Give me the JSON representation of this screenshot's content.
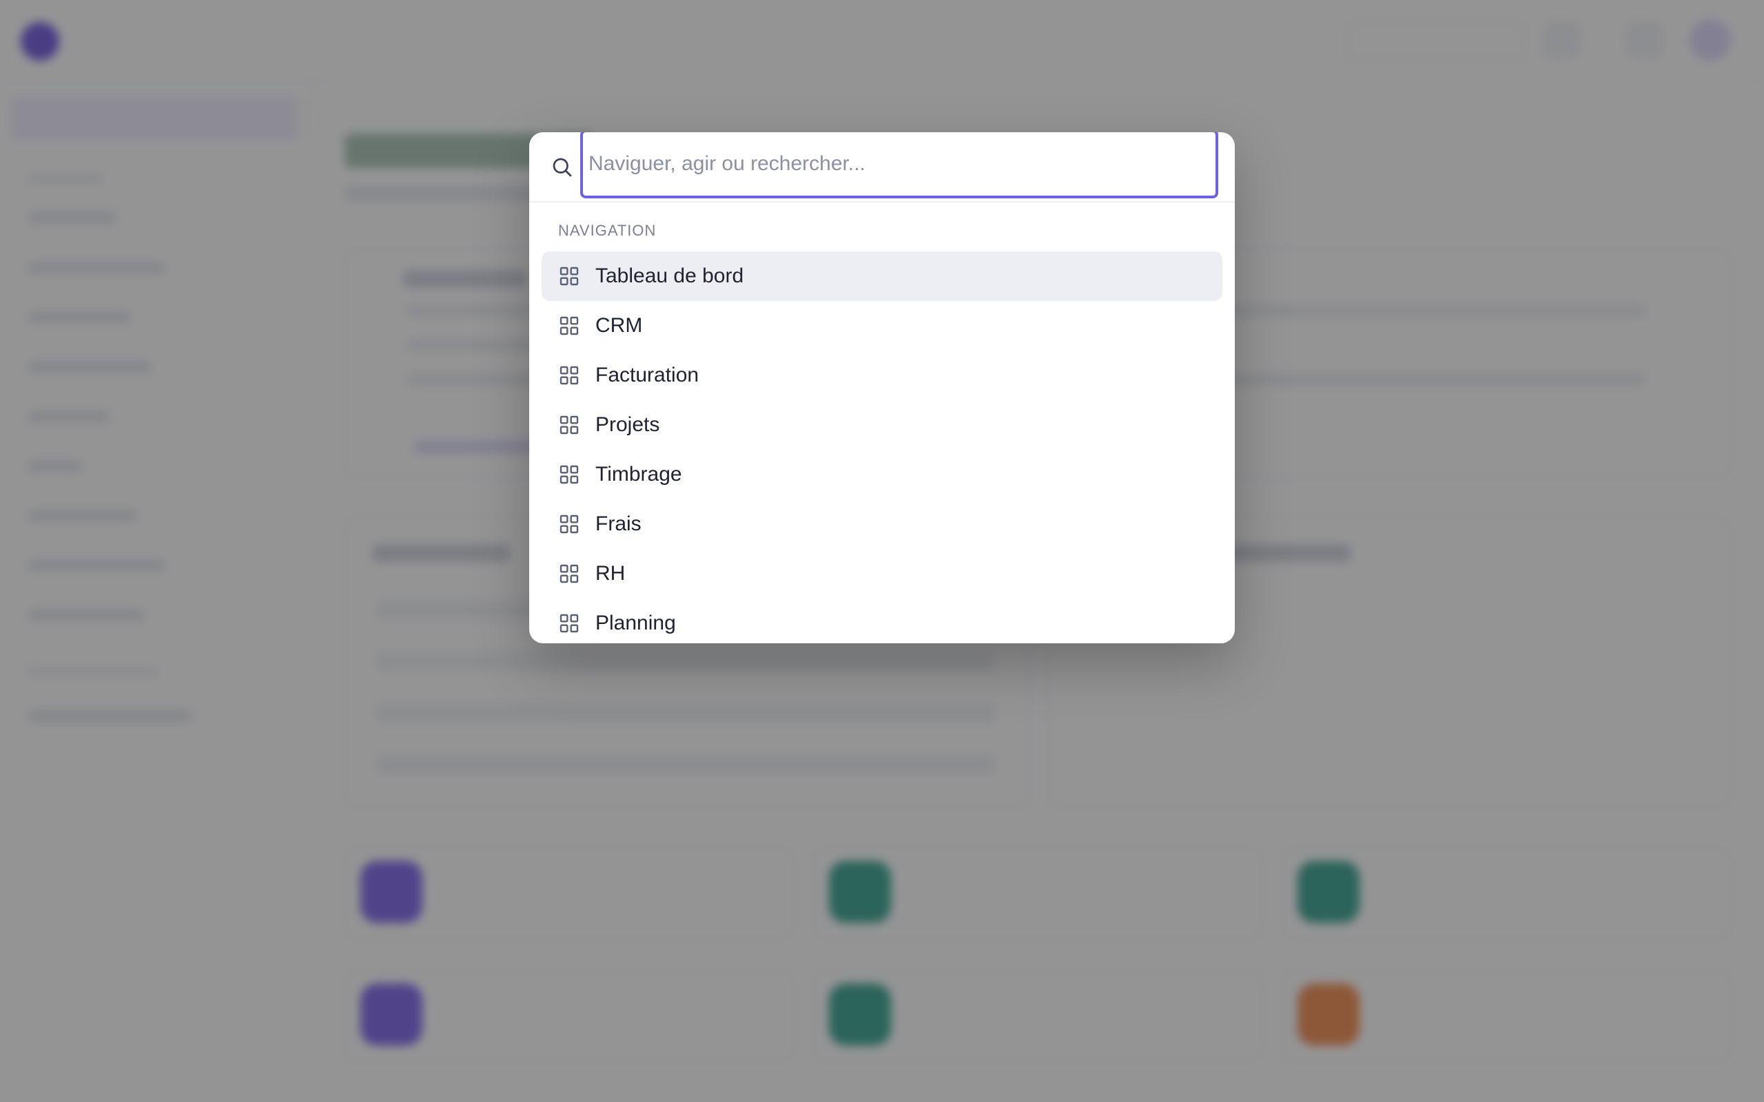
{
  "palette": {
    "search_placeholder": "Naviguer, agir ou rechercher...",
    "section_title": "NAVIGATION",
    "items": [
      {
        "label": "Tableau de bord",
        "icon": "grid-icon",
        "active": true
      },
      {
        "label": "CRM",
        "icon": "grid-icon"
      },
      {
        "label": "Facturation",
        "icon": "grid-icon"
      },
      {
        "label": "Projets",
        "icon": "grid-icon"
      },
      {
        "label": "Timbrage",
        "icon": "grid-icon"
      },
      {
        "label": "Frais",
        "icon": "grid-icon"
      },
      {
        "label": "RH",
        "icon": "grid-icon"
      },
      {
        "label": "Planning",
        "icon": "grid-icon"
      }
    ]
  },
  "colors": {
    "accent": "#6d62e6",
    "overlay": "#3c3c3e",
    "active_item_bg": "#edeef3"
  }
}
